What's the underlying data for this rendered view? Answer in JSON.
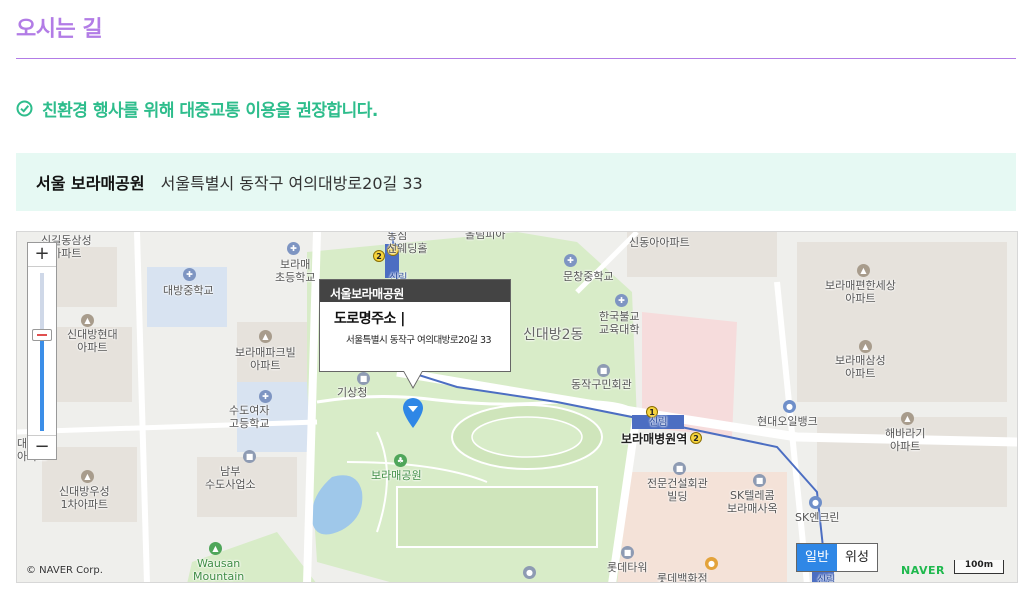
{
  "page": {
    "title": "오시는 길",
    "eco_notice": "친환경 행사를 위해 대중교통 이용을 권장합니다."
  },
  "address": {
    "name": "서울 보라매공원",
    "road_address": "서울특별시 동작구 여의대방로20길 33"
  },
  "map": {
    "info_window": {
      "title": "서울보라매공원",
      "label": "도로명주소 |",
      "address": "서울특별시 동작구 여의대방로20길 33"
    },
    "zoom": {
      "plus": "+",
      "minus": "−",
      "level": 0.61
    },
    "map_type": {
      "normal": "일반",
      "satellite": "위성",
      "selected": "일반"
    },
    "copyright": "© NAVER Corp.",
    "logo": "NAVER",
    "scale": "100m",
    "labels": {
      "sindaebang_2dong": "신대방2동",
      "boramae_park": "보라매공원",
      "boramae_station": "보라매병원역",
      "daebang_middle": "대방중학교",
      "boramae_elementary": "보라매\n초등학교",
      "sindaebang_hyundai": "신대방현대\n아파트",
      "boramae_park_hill": "보라매파크빌\n아파트",
      "gisangcheong": "기상청",
      "sudo_girls_high": "수도여자\n고등학교",
      "nambu_water": "남부\n수도사업소",
      "sindaebang_wooseong": "신대방우성\n1차아파트",
      "wausan_mountain": "Wausan\nMountain",
      "munchang_middle": "문창중학교",
      "sindong_apt": "신동아아파트",
      "korea_buddhist_univ": "한국불교\n교육대학",
      "dongjak_civic": "동작구민회관",
      "boramae_pyeonhan": "보라매편한세상\n아파트",
      "boramae_samsung": "보라매삼성\n아파트",
      "hyundai_oilbank": "현대오일뱅크",
      "haebaragi_apt": "해바라기\n아파트",
      "jeonmun_building": "전문건설회관\n빌딩",
      "sk_telecom": "SK텔레콤\n보라매사옥",
      "sk_encrin": "SK엔크린",
      "lotte_tower": "롯데타워",
      "lotte_dept": "롯데백화점",
      "sillim_top": "신림",
      "sillim_mid": "신림",
      "sillim_bottom": "신림",
      "sindaebang_ga": "신길동삼성\n아파트",
      "sindaebang_left_edge": "대\n아파트",
      "sinseon_wedding": "동심\n선웨딩홀",
      "top_hall": "올림피아"
    }
  }
}
